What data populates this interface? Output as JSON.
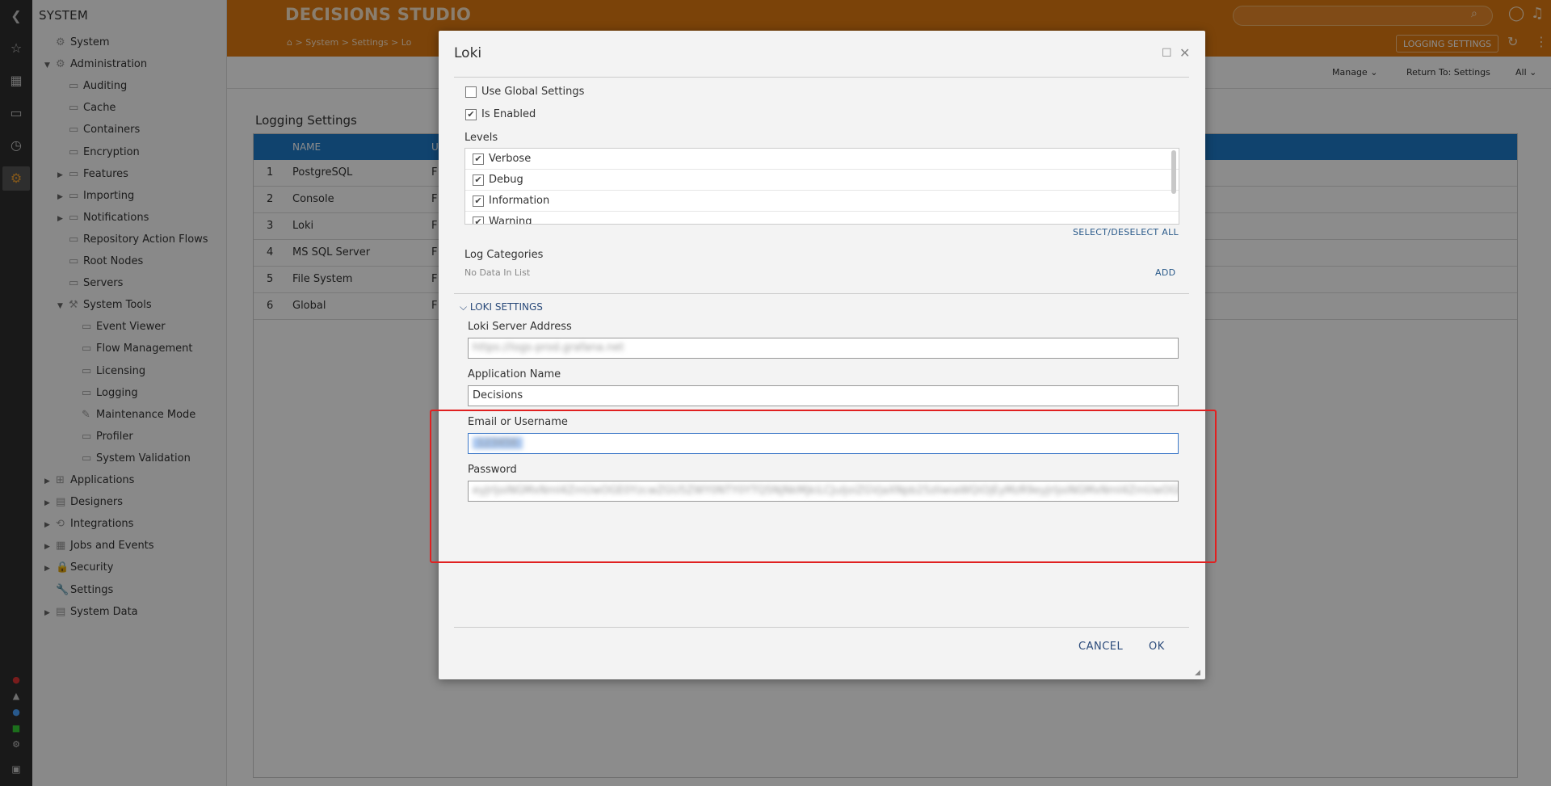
{
  "sidebar_icons": [
    "back-icon",
    "star-icon",
    "grid-icon",
    "folder-icon",
    "history-icon",
    "gear-icon"
  ],
  "tree": {
    "title": "SYSTEM",
    "items": [
      {
        "label": "System",
        "indent": 0,
        "arrow": "",
        "icon": "system-icon"
      },
      {
        "label": "Administration",
        "indent": 0,
        "arrow": "▼",
        "icon": "admin-icon"
      },
      {
        "label": "Auditing",
        "indent": 1,
        "arrow": "",
        "icon": "folder-icon"
      },
      {
        "label": "Cache",
        "indent": 1,
        "arrow": "",
        "icon": "folder-icon"
      },
      {
        "label": "Containers",
        "indent": 1,
        "arrow": "",
        "icon": "folder-icon"
      },
      {
        "label": "Encryption",
        "indent": 1,
        "arrow": "",
        "icon": "folder-icon"
      },
      {
        "label": "Features",
        "indent": 1,
        "arrow": "▶",
        "icon": "folder-icon"
      },
      {
        "label": "Importing",
        "indent": 1,
        "arrow": "▶",
        "icon": "folder-icon"
      },
      {
        "label": "Notifications",
        "indent": 1,
        "arrow": "▶",
        "icon": "folder-icon"
      },
      {
        "label": "Repository Action Flows",
        "indent": 1,
        "arrow": "",
        "icon": "folder-icon"
      },
      {
        "label": "Root Nodes",
        "indent": 1,
        "arrow": "",
        "icon": "folder-icon"
      },
      {
        "label": "Servers",
        "indent": 1,
        "arrow": "",
        "icon": "folder-icon"
      },
      {
        "label": "System Tools",
        "indent": 1,
        "arrow": "▼",
        "icon": "tools-icon"
      },
      {
        "label": "Event Viewer",
        "indent": 2,
        "arrow": "",
        "icon": "folder-icon"
      },
      {
        "label": "Flow Management",
        "indent": 2,
        "arrow": "",
        "icon": "folder-icon"
      },
      {
        "label": "Licensing",
        "indent": 2,
        "arrow": "",
        "icon": "folder-icon"
      },
      {
        "label": "Logging",
        "indent": 2,
        "arrow": "",
        "icon": "folder-icon"
      },
      {
        "label": "Maintenance Mode",
        "indent": 2,
        "arrow": "",
        "icon": "maintenance-icon"
      },
      {
        "label": "Profiler",
        "indent": 2,
        "arrow": "",
        "icon": "folder-icon"
      },
      {
        "label": "System Validation",
        "indent": 2,
        "arrow": "",
        "icon": "folder-icon"
      },
      {
        "label": "Applications",
        "indent": 0,
        "arrow": "▶",
        "icon": "apps-icon"
      },
      {
        "label": "Designers",
        "indent": 0,
        "arrow": "▶",
        "icon": "designers-icon"
      },
      {
        "label": "Integrations",
        "indent": 0,
        "arrow": "▶",
        "icon": "integrations-icon"
      },
      {
        "label": "Jobs and Events",
        "indent": 0,
        "arrow": "▶",
        "icon": "jobs-icon"
      },
      {
        "label": "Security",
        "indent": 0,
        "arrow": "▶",
        "icon": "lock-icon"
      },
      {
        "label": "Settings",
        "indent": 0,
        "arrow": "",
        "icon": "wrench-icon"
      },
      {
        "label": "System Data",
        "indent": 0,
        "arrow": "▶",
        "icon": "data-icon"
      }
    ]
  },
  "header": {
    "logo": "DECISIONS STUDIO",
    "breadcrumb": "⌂  >  System  >  Settings  >  Lo",
    "logging_settings_button": "LOGGING SETTINGS"
  },
  "subbar": {
    "manage": "Manage ⌄",
    "return_to": "Return To: Settings",
    "all": "All ⌄"
  },
  "content": {
    "title": "Logging Settings",
    "column_name": "NAME",
    "column_2": "U",
    "rows": [
      {
        "num": "1",
        "name": "PostgreSQL",
        "col2": "F"
      },
      {
        "num": "2",
        "name": "Console",
        "col2": "F"
      },
      {
        "num": "3",
        "name": "Loki",
        "col2": "F"
      },
      {
        "num": "4",
        "name": "MS SQL Server",
        "col2": "F"
      },
      {
        "num": "5",
        "name": "File System",
        "col2": "F"
      },
      {
        "num": "6",
        "name": "Global",
        "col2": "F"
      }
    ]
  },
  "modal": {
    "title": "Loki",
    "use_global_settings": "Use Global Settings",
    "is_enabled": "Is Enabled",
    "levels_label": "Levels",
    "levels": [
      "Verbose",
      "Debug",
      "Information",
      "Warning"
    ],
    "select_deselect_all": "SELECT/DESELECT ALL",
    "log_categories_label": "Log Categories",
    "no_data": "No Data In List",
    "add": "ADD",
    "loki_settings": "LOKI SETTINGS",
    "server_address_label": "Loki Server Address",
    "server_address_value": "https://logs-prod.grafana.net",
    "app_name_label": "Application Name",
    "app_name_value": "Decisions",
    "email_label": "Email or Username",
    "email_value": "123456",
    "password_label": "Password",
    "password_value": "eyJrIjoiNGMxNmI4ZmUwOGE0YzcwZGU5ZWY0NTY0YTQ5NjNkMjkiLCJuIjoiZGVjaXNpb25zIiwiaWQiOjEyMzR9eyJrIjoiNGMxNmI4ZmUwOGE0YzcwZGU5",
    "cancel": "CANCEL",
    "ok": "OK"
  },
  "colors": {
    "accent": "#e07a12",
    "grid_header": "#1e7ac8",
    "highlight": "#e02020"
  }
}
